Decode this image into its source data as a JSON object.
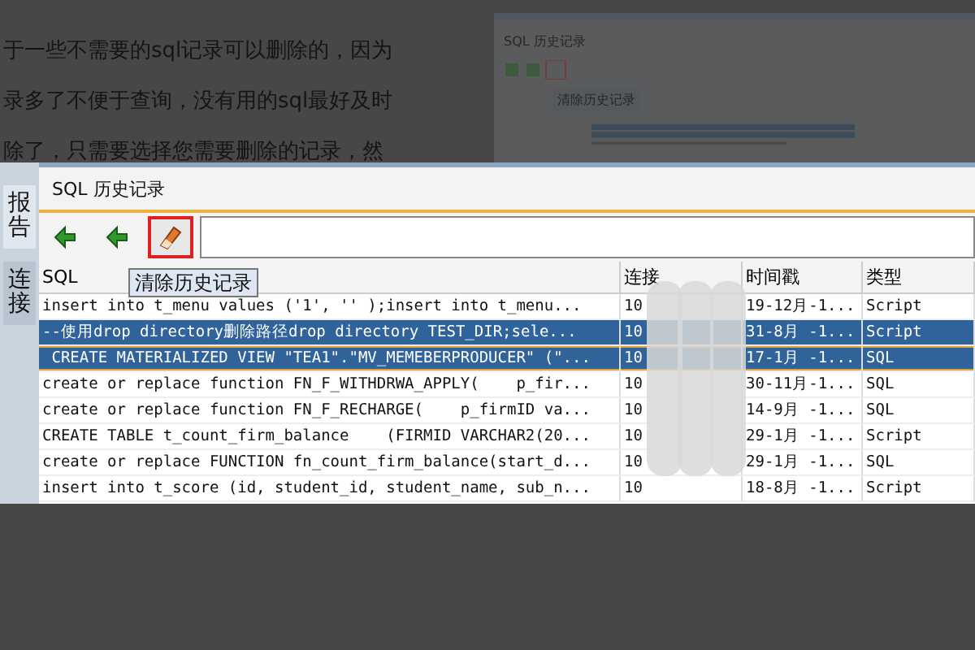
{
  "article": {
    "lines": [
      "于一些不需要的sql记录可以删除的，因为",
      "录多了不便于查询，没有用的sql最好及时",
      "除了，只需要选择您需要删除的记录，然"
    ]
  },
  "thumbnail": {
    "title": "SQL 历史记录",
    "tooltip": "清除历史记录"
  },
  "side_tabs": [
    {
      "label": "报告",
      "selected": true
    },
    {
      "label": "连接",
      "selected": false
    }
  ],
  "panel": {
    "title": "SQL 历史记录"
  },
  "toolbar": {
    "tooltip": "清除历史记录",
    "eraser_highlighted": true
  },
  "table": {
    "columns": [
      "SQL",
      "连接",
      "时间戳",
      "类型"
    ],
    "rows": [
      {
        "cells": [
          "insert into t_menu values ('1', '' );insert into t_menu...",
          "10",
          "19-12月-1...",
          "Script"
        ],
        "selected": false,
        "focused": false
      },
      {
        "cells": [
          "--使用drop directory删除路径drop directory TEST_DIR;sele...",
          "10",
          "31-8月 -1...",
          "Script"
        ],
        "selected": true,
        "focused": false
      },
      {
        "cells": [
          " CREATE MATERIALIZED VIEW \"TEA1\".\"MV_MEMEBERPRODUCER\" (\"...",
          "10",
          "17-1月 -1...",
          "SQL"
        ],
        "selected": true,
        "focused": true
      },
      {
        "cells": [
          "create or replace function FN_F_WITHDRWA_APPLY(    p_fir...",
          "10",
          "30-11月-1...",
          "SQL"
        ],
        "selected": false,
        "focused": false
      },
      {
        "cells": [
          "create or replace function FN_F_RECHARGE(    p_firmID va...",
          "10",
          "14-9月 -1...",
          "SQL"
        ],
        "selected": false,
        "focused": false
      },
      {
        "cells": [
          "CREATE TABLE t_count_firm_balance    (FIRMID VARCHAR2(20...",
          "10",
          "29-1月 -1...",
          "Script"
        ],
        "selected": false,
        "focused": false
      },
      {
        "cells": [
          "create or replace FUNCTION fn_count_firm_balance(start_d...",
          "10",
          "29-1月 -1...",
          "SQL"
        ],
        "selected": false,
        "focused": false
      },
      {
        "cells": [
          "insert into t_score (id, student_id, student_name, sub_n...",
          "10",
          "18-8月 -1...",
          "Script"
        ],
        "selected": false,
        "focused": false
      }
    ]
  }
}
